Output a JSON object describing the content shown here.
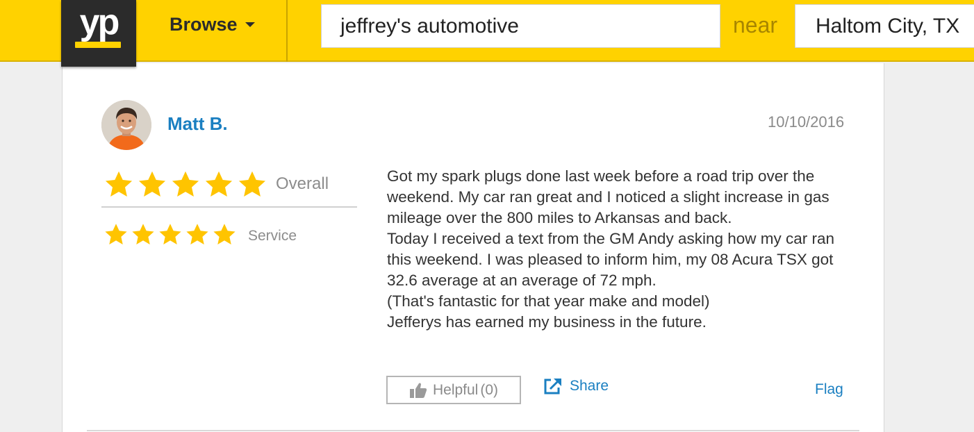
{
  "header": {
    "logo_text": "yp",
    "browse_label": "Browse",
    "search_value": "jeffrey's automotive",
    "near_label": "near",
    "location_value": "Haltom City, TX"
  },
  "colors": {
    "brand_yellow": "#ffd200",
    "logo_dark": "#2b2b2b",
    "link_blue": "#1a7fc1",
    "star_gold": "#ffc400"
  },
  "review": {
    "reviewer_name": "Matt B.",
    "date": "10/10/2016",
    "ratings": [
      {
        "label": "Overall",
        "stars": 5
      },
      {
        "label": "Service",
        "stars": 5
      }
    ],
    "text_lines": [
      "Got my spark plugs done last week before a road trip over the weekend. My car ran great and I noticed a slight increase in gas mileage over the 800 miles to Arkansas and back.",
      "Today I received a text from the GM Andy asking how my car ran this weekend. I was pleased to inform him, my 08 Acura TSX got 32.6 average at an average of 72 mph.",
      "(That's fantastic for that year make and model)",
      "Jefferys has earned my business in the future."
    ],
    "actions": {
      "helpful_label": "Helpful",
      "helpful_count": "(0)",
      "share_label": "Share",
      "flag_label": "Flag"
    }
  },
  "icons": [
    "thumbs-up-icon",
    "share-icon",
    "star-icon",
    "chevron-down-icon"
  ]
}
